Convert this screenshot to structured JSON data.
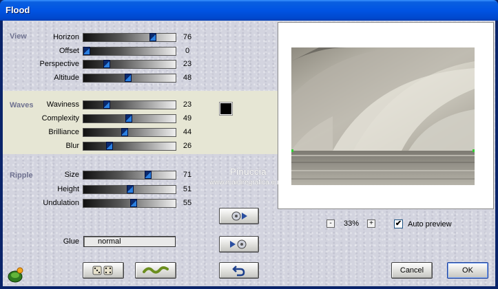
{
  "window": {
    "title": "Flood"
  },
  "sections": {
    "view": "View",
    "waves": "Waves",
    "ripple": "Ripple"
  },
  "sliders": [
    {
      "label": "Horizon",
      "value": 76
    },
    {
      "label": "Offset",
      "value": 0
    },
    {
      "label": "Perspective",
      "value": 23
    },
    {
      "label": "Altitude",
      "value": 48
    },
    {
      "label": "Waviness",
      "value": 23
    },
    {
      "label": "Complexity",
      "value": 49
    },
    {
      "label": "Brilliance",
      "value": 44
    },
    {
      "label": "Blur",
      "value": 26
    },
    {
      "label": "Size",
      "value": 71
    },
    {
      "label": "Height",
      "value": 51
    },
    {
      "label": "Undulation",
      "value": 55
    }
  ],
  "color_swatch": "#000000",
  "glue": {
    "label": "Glue",
    "value": "normal"
  },
  "zoom": {
    "minus": "-",
    "value": "33%",
    "plus": "+"
  },
  "auto_preview": {
    "label": "Auto preview",
    "checked": true,
    "mark": "✔"
  },
  "buttons": {
    "cancel": "Cancel",
    "ok": "OK"
  },
  "watermark": {
    "line1": "Pinuccia",
    "line2": "www.maidiregrafica.eu"
  },
  "icons": {
    "plugin": "plugin-frog-icon",
    "randomize": "dice-icon",
    "reset": "wave-icon",
    "play_forward": "film-forward-icon",
    "play_back": "film-back-icon",
    "undo": "undo-arrow-icon"
  }
}
